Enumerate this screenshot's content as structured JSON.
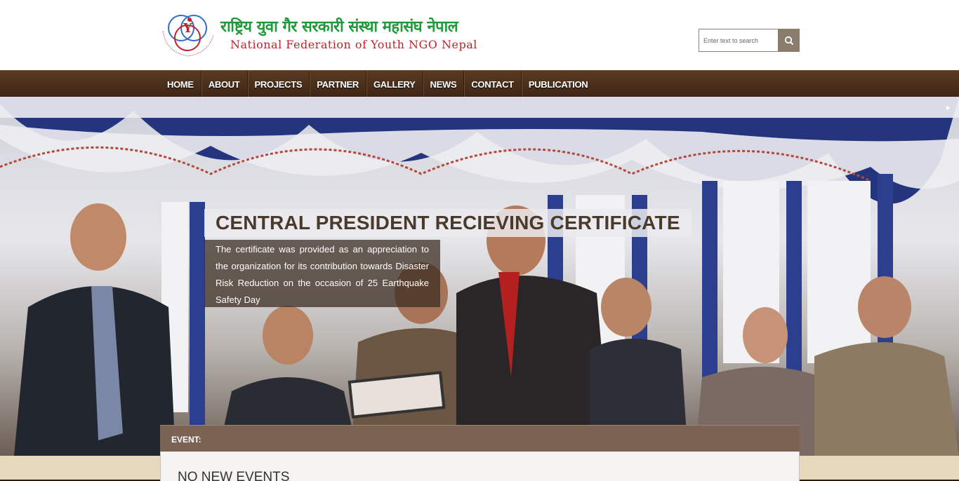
{
  "header": {
    "title_nepali": "राष्ट्रिय युवा गैर सरकारी संस्था महासंघ नेपाल",
    "title_english": "National Federation of Youth NGO Nepal",
    "logo_ring_text": "National Federation Of Youth NGO Nepal",
    "logo_letter": "Y"
  },
  "search": {
    "placeholder": "Enter text to search",
    "icon": "search-icon"
  },
  "nav": {
    "items": [
      "HOME",
      "ABOUT",
      "PROJECTS",
      "PARTNER",
      "GALLERY",
      "NEWS",
      "CONTACT",
      "PUBLICATION"
    ]
  },
  "slide": {
    "title": "CENTRAL PRESIDENT RECIEVING CERTIFICATE",
    "description": "The certificate was provided as an appreciation to the organization for its contribution towards Disaster Risk Reduction on the occasion of 25 Earthquake Safety Day",
    "next_icon": "chevron-right-icon"
  },
  "event": {
    "label": "EVENT:",
    "empty_text": "NO NEW EVENTS"
  },
  "colors": {
    "brand_green": "#1f9a3a",
    "brand_red": "#c0232a",
    "nav_brown": "#4a2e1a",
    "event_brown": "#7a6352",
    "search_button": "#8b7d6e"
  }
}
